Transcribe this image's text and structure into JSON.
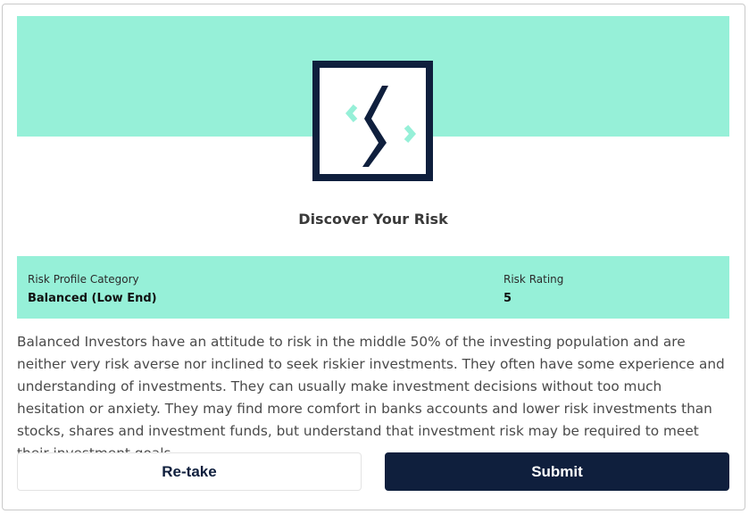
{
  "header": {
    "title": "Discover Your Risk",
    "logo_icon": "risk-logo-icon"
  },
  "profile": {
    "category_label": "Risk Profile Category",
    "category_value": "Balanced (Low End)",
    "rating_label": "Risk Rating",
    "rating_value": "5"
  },
  "description": "Balanced Investors have an attitude to risk in the middle 50% of the investing population and are neither very risk averse nor inclined to seek riskier investments. They often have some experience and understanding of investments. They can usually make investment decisions without too much hesitation or anxiety. They may find more comfort in banks accounts and lower risk investments than stocks, shares and investment funds, but understand that investment risk may be required to meet their investment goals.",
  "actions": {
    "retake_label": "Re-take",
    "submit_label": "Submit"
  },
  "colors": {
    "accent": "#96f0d8",
    "brand_dark": "#0f1f3d"
  }
}
